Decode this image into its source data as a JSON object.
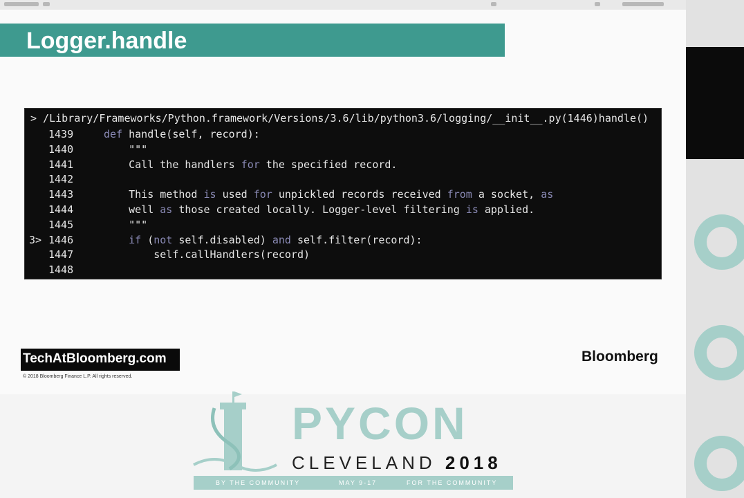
{
  "slide": {
    "title": "Logger.handle"
  },
  "terminal": {
    "path": "> /Library/Frameworks/Python.framework/Versions/3.6/lib/python3.6/logging/__init__.py(1446)handle()",
    "lines": [
      {
        "marker": "",
        "num": "1439",
        "code": "def handle(self, record):"
      },
      {
        "marker": "",
        "num": "1440",
        "code": "    \"\"\""
      },
      {
        "marker": "",
        "num": "1441",
        "code": "    Call the handlers for the specified record."
      },
      {
        "marker": "",
        "num": "1442",
        "code": ""
      },
      {
        "marker": "",
        "num": "1443",
        "code": "    This method is used for unpickled records received from a socket, as"
      },
      {
        "marker": "",
        "num": "1444",
        "code": "    well as those created locally. Logger-level filtering is applied."
      },
      {
        "marker": "",
        "num": "1445",
        "code": "    \"\"\""
      },
      {
        "marker": "3>",
        "num": "1446",
        "code": "    if (not self.disabled) and self.filter(record):"
      },
      {
        "marker": "",
        "num": "1447",
        "code": "        self.callHandlers(record)"
      },
      {
        "marker": "",
        "num": "1448",
        "code": ""
      }
    ]
  },
  "footer": {
    "site": "TechAtBloomberg.com",
    "copyright": "© 2018 Bloomberg Finance L.P. All rights reserved.",
    "company": "Bloomberg"
  },
  "pycon": {
    "word": "PYCON",
    "city": "CLEVELAND",
    "year": "2018",
    "banner_left": "BY THE COMMUNITY",
    "banner_mid": "MAY 9-17",
    "banner_right": "FOR THE COMMUNITY"
  },
  "colors": {
    "accent": "#3e9a8f",
    "pycon_teal": "#a6cfc9",
    "terminal_bg": "#0d0d0d",
    "keyword": "#8a8ab5"
  }
}
